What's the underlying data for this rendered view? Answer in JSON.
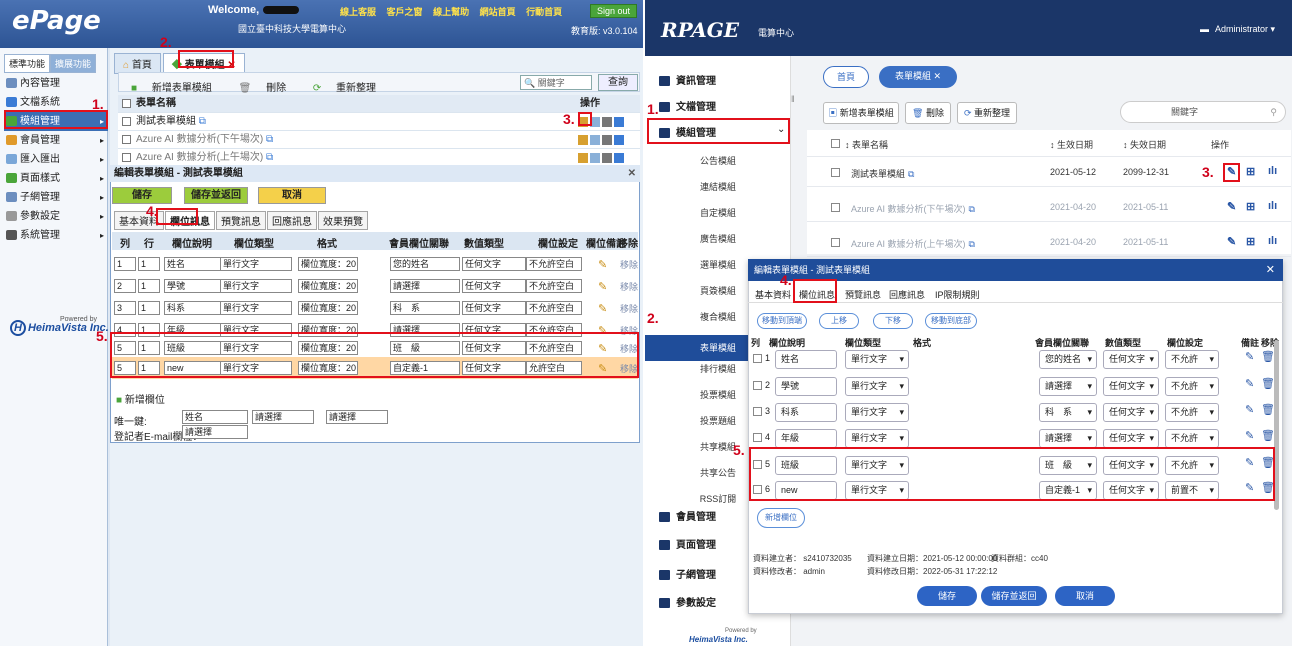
{
  "left": {
    "logo": "ePage",
    "welcome": "Welcome,",
    "school": "國立臺中科技大學電算中心",
    "toplinks": [
      "線上客服",
      "客戶之窗",
      "線上幫助",
      "網站首頁",
      "行動首頁"
    ],
    "signout": "Sign out",
    "version": "教育版: v3.0.104",
    "side_tabs": [
      "標準功能",
      "擴展功能"
    ],
    "menu": [
      {
        "label": "內容管理",
        "color": "#6c8ebf",
        "arrow": ""
      },
      {
        "label": "文檔系統",
        "color": "#3a7bd5",
        "arrow": ""
      },
      {
        "label": "模組管理",
        "color": "#4aa53a",
        "arrow": "▸"
      },
      {
        "label": "會員管理",
        "color": "#e09a2a",
        "arrow": "▸"
      },
      {
        "label": "匯入匯出",
        "color": "#7aa7d8",
        "arrow": "▸"
      },
      {
        "label": "頁面樣式",
        "color": "#4aa53a",
        "arrow": "▸"
      },
      {
        "label": "子網管理",
        "color": "#6c8ebf",
        "arrow": "▸"
      },
      {
        "label": "參數設定",
        "color": "#999999",
        "arrow": "▸"
      },
      {
        "label": "系統管理",
        "color": "#555555",
        "arrow": "▸"
      }
    ],
    "brand": "HeimaVista Inc.",
    "brand_small": "Powered by",
    "tabs": [
      "首頁",
      "表單模組"
    ],
    "toolbar": [
      "新增表單模組",
      "刪除",
      "重新整理"
    ],
    "keyword_placeholder": "關鍵字",
    "query": "查詢",
    "grid_header": "表單名稱",
    "grid_op": "操作",
    "grid_rows": [
      "測試表單模組",
      "Azure AI 數據分析(下午場次)",
      "Azure AI 數據分析(上午場次)"
    ],
    "dialog_title": "編輯表單模組 - 測試表單模組",
    "btn_save": "儲存",
    "btn_save_back": "儲存並返回",
    "btn_cancel": "取消",
    "form_tabs": [
      "基本資料",
      "欄位訊息",
      "預覽訊息",
      "回應訊息",
      "效果預覽"
    ],
    "field_header": [
      "列",
      "行",
      "欄位說明",
      "欄位類型",
      "格式",
      "會員欄位關聯",
      "數值類型",
      "欄位設定",
      "欄位備註",
      "移除"
    ],
    "fields": [
      {
        "row": "1",
        "col": "1",
        "name": "姓名",
        "type": "單行文字",
        "fmt": "欄位寬度：20",
        "member": "您的姓名",
        "num": "任何文字",
        "setting": "不允許空白",
        "remove": "移除"
      },
      {
        "row": "2",
        "col": "1",
        "name": "學號",
        "type": "單行文字",
        "fmt": "欄位寬度：20",
        "member": "請選擇",
        "num": "任何文字",
        "setting": "不允許空白",
        "remove": "移除"
      },
      {
        "row": "3",
        "col": "1",
        "name": "科系",
        "type": "單行文字",
        "fmt": "欄位寬度：20",
        "member": "科　系",
        "num": "任何文字",
        "setting": "不允許空白",
        "remove": "移除"
      },
      {
        "row": "4",
        "col": "1",
        "name": "年級",
        "type": "單行文字",
        "fmt": "欄位寬度：20",
        "member": "請選擇",
        "num": "任何文字",
        "setting": "不允許空白",
        "remove": "移除"
      },
      {
        "row": "5",
        "col": "1",
        "name": "班級",
        "type": "單行文字",
        "fmt": "欄位寬度：20",
        "member": "班　級",
        "num": "任何文字",
        "setting": "不允許空白",
        "remove": "移除"
      },
      {
        "row": "5",
        "col": "1",
        "name": "new",
        "type": "單行文字",
        "fmt": "欄位寬度：20",
        "member": "自定義-1",
        "num": "任何文字",
        "setting": "允許空白",
        "remove": "移除"
      }
    ],
    "add_field": "新增欄位",
    "unique_key": "唯一鍵:",
    "unique_vals": [
      "姓名",
      "請選擇",
      "請選擇"
    ],
    "email_label": "登記者E-mail欄位：",
    "email_val": "請選擇"
  },
  "right": {
    "logo": "RPAGE",
    "center": "電算中心",
    "admin": "Administrator ▾",
    "menu": [
      "資訊管理",
      "文檔管理",
      "模組管理",
      "會員管理",
      "頁面管理",
      "子網管理",
      "參數設定"
    ],
    "submenu": [
      "公告模組",
      "連結模組",
      "自定模組",
      "廣告模組",
      "選單模組",
      "頁簽模組",
      "複合模組",
      "表單模組",
      "排行模組",
      "投票模組",
      "投票題組",
      "共享模組",
      "共享公告",
      "RSS訂閱"
    ],
    "brand_small": "Powered by",
    "brand": "HeimaVista Inc.",
    "tabs": [
      "首頁",
      "表單模組"
    ],
    "toolbar": [
      "新增表單模組",
      "刪除",
      "重新整理"
    ],
    "keyword_placeholder": "關鍵字",
    "grid_header": [
      "表單名稱",
      "生效日期",
      "失效日期",
      "操作"
    ],
    "grid_rows": [
      {
        "name": "測試表單模組",
        "start": "2021-05-12",
        "end": "2099-12-31",
        "muted": false
      },
      {
        "name": "Azure AI 數據分析(下午場次)",
        "start": "2021-04-20",
        "end": "2021-05-11",
        "muted": true
      },
      {
        "name": "Azure AI 數據分析(上午場次)",
        "start": "2021-04-20",
        "end": "2021-05-11",
        "muted": true
      }
    ],
    "dialog_title": "編輯表單模組 - 測試表單模組",
    "dialog_tabs": [
      "基本資料",
      "欄位訊息",
      "預覽訊息",
      "回應訊息",
      "IP限制規則"
    ],
    "move_btns": [
      "移動到頂端",
      "上移",
      "下移",
      "移動到底部"
    ],
    "field_header": [
      "列",
      "欄位說明",
      "欄位類型",
      "格式",
      "會員欄位關聯",
      "數值類型",
      "欄位設定",
      "備註",
      "移除"
    ],
    "fields": [
      {
        "n": "1",
        "name": "姓名",
        "type": "單行文字",
        "member": "您的姓名",
        "num": "任何文字",
        "setting": "不允許"
      },
      {
        "n": "2",
        "name": "學號",
        "type": "單行文字",
        "member": "請選擇",
        "num": "任何文字",
        "setting": "不允許"
      },
      {
        "n": "3",
        "name": "科系",
        "type": "單行文字",
        "member": "科　系",
        "num": "任何文字",
        "setting": "不允許"
      },
      {
        "n": "4",
        "name": "年級",
        "type": "單行文字",
        "member": "請選擇",
        "num": "任何文字",
        "setting": "不允許"
      },
      {
        "n": "5",
        "name": "班級",
        "type": "單行文字",
        "member": "班　級",
        "num": "任何文字",
        "setting": "不允許"
      },
      {
        "n": "6",
        "name": "new",
        "type": "單行文字",
        "member": "自定義-1",
        "num": "任何文字",
        "setting": "前置不"
      }
    ],
    "add_field": "新增欄位",
    "creator": "資料建立者： s2410732035",
    "created": "資料建立日期：2021-05-12 00:00:00",
    "group": "資料群組：cc40",
    "modifier": "資料修改者： admin",
    "modified": "資料修改日期：2022-05-31 17:22:12",
    "btn_save": "儲存",
    "btn_save_back": "儲存並返回",
    "btn_cancel": "取消"
  },
  "annotations": [
    "1.",
    "2.",
    "3.",
    "4.",
    "5."
  ]
}
